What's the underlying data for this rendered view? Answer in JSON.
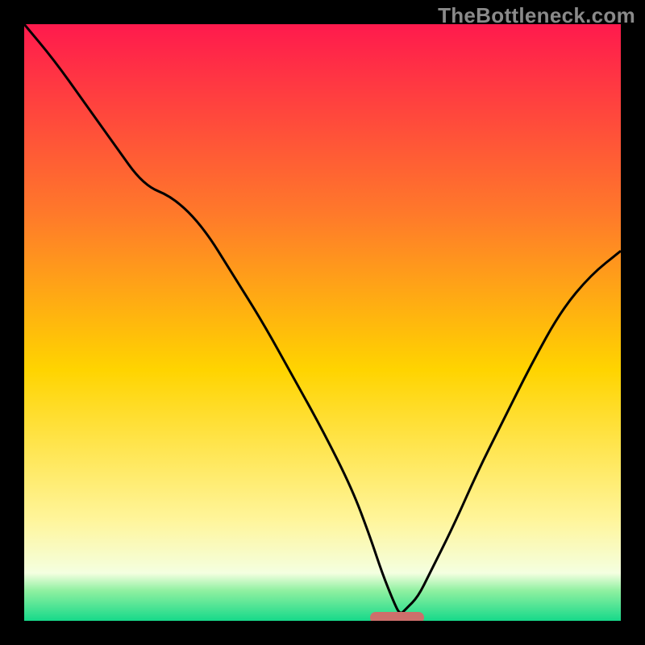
{
  "watermark": {
    "text": "TheBottleneck.com"
  },
  "colors": {
    "top": "#ff1a4d",
    "mid_upper": "#ff7a2a",
    "mid": "#ffd400",
    "mid_lower": "#fff59a",
    "low_pale": "#f4ffe0",
    "low_green": "#8ef0a0",
    "bottom": "#16d98a",
    "marker": "#cd6f6b",
    "curve": "#000000"
  },
  "chart_data": {
    "type": "line",
    "title": "",
    "xlabel": "",
    "ylabel": "",
    "x_range": [
      0,
      100
    ],
    "y_range": [
      0,
      100
    ],
    "optimum_x": 63,
    "series": [
      {
        "name": "bottleneck-curve",
        "x": [
          0,
          5,
          10,
          15,
          20,
          25,
          30,
          35,
          40,
          45,
          50,
          55,
          58,
          60,
          62,
          63,
          64,
          66,
          68,
          72,
          76,
          80,
          85,
          90,
          95,
          100
        ],
        "y": [
          100,
          94,
          87,
          80,
          73,
          71,
          66,
          58,
          50,
          41,
          32,
          22,
          14,
          8,
          3,
          1,
          2,
          4,
          8,
          16,
          25,
          33,
          43,
          52,
          58,
          62
        ]
      }
    ],
    "marker": {
      "x_start": 58,
      "x_end": 67,
      "y": 0.5
    },
    "gradient_stops": [
      {
        "pct": 0,
        "color_key": "top"
      },
      {
        "pct": 32,
        "color_key": "mid_upper"
      },
      {
        "pct": 58,
        "color_key": "mid"
      },
      {
        "pct": 83,
        "color_key": "mid_lower"
      },
      {
        "pct": 92,
        "color_key": "low_pale"
      },
      {
        "pct": 95,
        "color_key": "low_green"
      },
      {
        "pct": 100,
        "color_key": "bottom"
      }
    ]
  }
}
